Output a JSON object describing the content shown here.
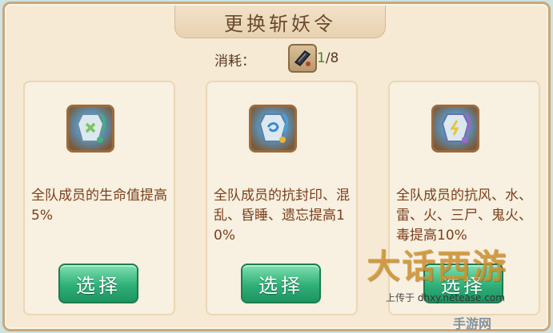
{
  "window": {
    "title": "更换斩妖令"
  },
  "cost": {
    "label": "消耗：",
    "current": "1",
    "total": "/8",
    "item_icon": "token-icon"
  },
  "cards": [
    {
      "icon": "green-jade-token-icon",
      "description": "全队成员的生命值提高5%",
      "button_label": "选择"
    },
    {
      "icon": "blue-jade-token-icon",
      "description": "全队成员的抗封印、混乱、昏睡、遗忘提高10%",
      "button_label": "选择"
    },
    {
      "icon": "purple-jade-token-icon",
      "description": "全队成员的抗风、水、雷、火、三尸、鬼火、毒提高10%",
      "button_label": "选择"
    }
  ],
  "watermark": {
    "logo": "大话西游",
    "upload_prefix": "上传于",
    "url": "dhxy.netease.com",
    "corner": "手游网"
  },
  "colors": {
    "panel": "#f6ead5",
    "button": "#2fb078",
    "desc_text": "#7b3f1b",
    "count_green": "#3a8a2e"
  }
}
